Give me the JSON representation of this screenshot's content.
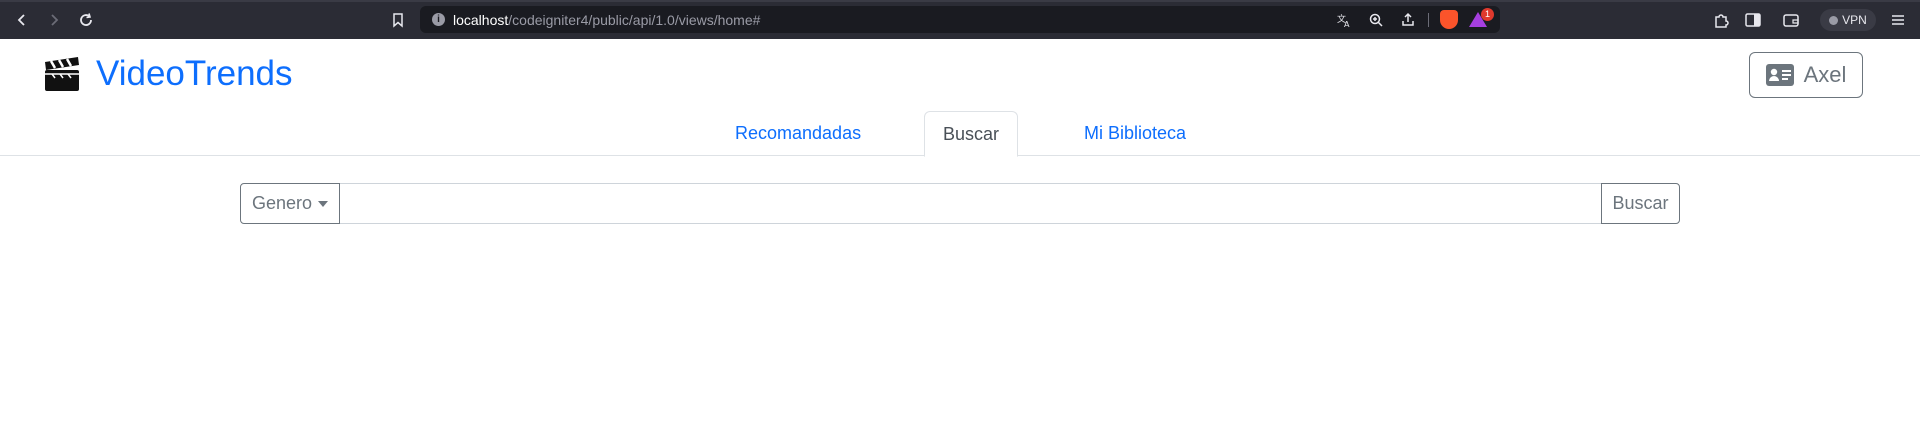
{
  "browser": {
    "url_host": "localhost",
    "url_path": "/codeigniter4/public/api/1.0/views/home#",
    "rewards_badge": "1",
    "vpn_label": "VPN"
  },
  "app": {
    "brand": "VideoTrends",
    "brand_icon": "clapperboard-icon",
    "user_name": "Axel",
    "user_icon": "id-card-icon",
    "accent_color": "#0d6efd"
  },
  "tabs": [
    {
      "label": "Recomandadas",
      "active": false
    },
    {
      "label": "Buscar",
      "active": true
    },
    {
      "label": "Mi Biblioteca",
      "active": false
    }
  ],
  "search": {
    "genre_label": "Genero",
    "input_value": "",
    "button_label": "Buscar"
  }
}
